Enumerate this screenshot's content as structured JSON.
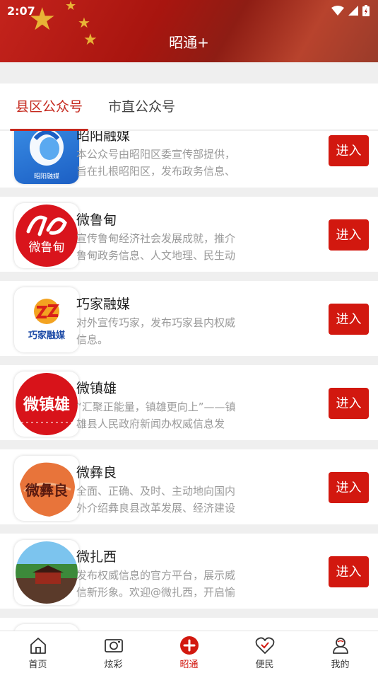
{
  "status": {
    "time": "2:07"
  },
  "header": {
    "title": "昭通+"
  },
  "tabs": [
    {
      "label": "县区公众号",
      "active": true
    },
    {
      "label": "市直公众号",
      "active": false
    }
  ],
  "accounts": [
    {
      "name": "昭阳融媒",
      "desc": "本公众号由昭阳区委宣传部提供，旨在扎根昭阳区，发布政务信息、",
      "enter": "进入",
      "logo_text": "昭阳融媒"
    },
    {
      "name": "微鲁甸",
      "desc": "宣传鲁甸经济社会发展成就，推介鲁甸政务信息、人文地理、民生动",
      "enter": "进入",
      "logo_text": "微鲁甸"
    },
    {
      "name": "巧家融媒",
      "desc": "对外宣传巧家，发布巧家县内权威信息。",
      "enter": "进入",
      "logo_text": "巧家融媒"
    },
    {
      "name": "微镇雄",
      "desc": "“汇聚正能量，镇雄更向上”——镇雄县人民政府新闻办权威信息发",
      "enter": "进入",
      "logo_text": "微镇雄"
    },
    {
      "name": "微彝良",
      "desc": "全面、正确、及时、主动地向国内外介绍彝良县改革发展、经济建设",
      "enter": "进入",
      "logo_text": "微彝良"
    },
    {
      "name": "微扎西",
      "desc": "发布权威信息的官方平台，展示威信新形象。欢迎@微扎西，开启愉",
      "enter": "进入",
      "logo_text": ""
    }
  ],
  "nav": [
    {
      "label": "首页",
      "icon": "home-icon"
    },
    {
      "label": "炫彩",
      "icon": "camera-icon"
    },
    {
      "label": "昭通",
      "icon": "plus-circle-icon",
      "active": true
    },
    {
      "label": "便民",
      "icon": "heart-check-icon"
    },
    {
      "label": "我的",
      "icon": "user-icon"
    }
  ],
  "colors": {
    "accent": "#d2180f",
    "tab_active": "#c5281d",
    "header": "#b41e14"
  }
}
